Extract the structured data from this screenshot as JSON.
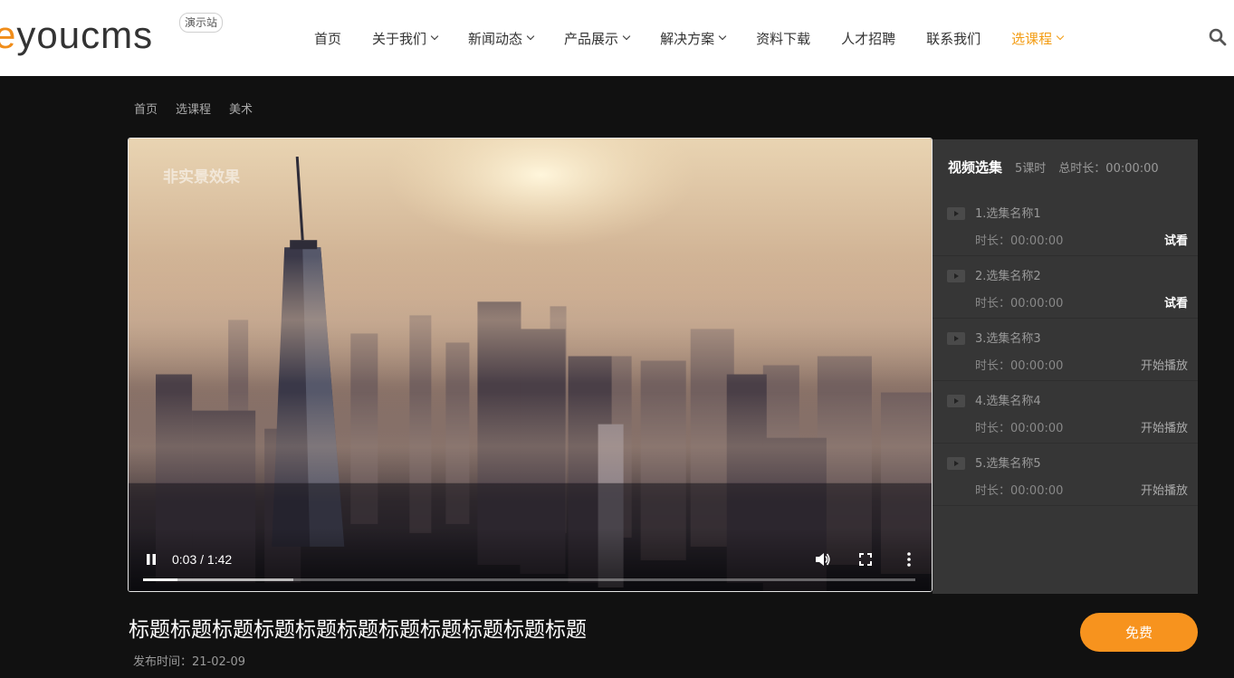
{
  "header": {
    "logo": {
      "accent": "e",
      "rest": "youcms"
    },
    "badge": "演示站",
    "nav": [
      {
        "label": "首页",
        "dropdown": false,
        "active": false
      },
      {
        "label": "关于我们",
        "dropdown": true,
        "active": false
      },
      {
        "label": "新闻动态",
        "dropdown": true,
        "active": false
      },
      {
        "label": "产品展示",
        "dropdown": true,
        "active": false
      },
      {
        "label": "解决方案",
        "dropdown": true,
        "active": false
      },
      {
        "label": "资料下载",
        "dropdown": false,
        "active": false
      },
      {
        "label": "人才招聘",
        "dropdown": false,
        "active": false
      },
      {
        "label": "联系我们",
        "dropdown": false,
        "active": false
      },
      {
        "label": "选课程",
        "dropdown": true,
        "active": true
      }
    ],
    "search_icon": "search-icon"
  },
  "breadcrumb": [
    "首页",
    "选课程",
    "美术"
  ],
  "player": {
    "watermark": "非实景效果",
    "time_display": "0:03 / 1:42",
    "current_time": "0:03",
    "duration": "1:42",
    "played_fraction": 0.045,
    "buffered_fraction": 0.195,
    "icons": [
      "pause-icon",
      "volume-icon",
      "fullscreen-icon",
      "more-vertical-icon"
    ]
  },
  "episodes": {
    "title": "视频选集",
    "count": "5课时",
    "total": "总时长：00:00:00",
    "items": [
      {
        "name": "1.选集名称1",
        "duration": "时长：00:00:00",
        "action": "试看",
        "trial": true
      },
      {
        "name": "2.选集名称2",
        "duration": "时长：00:00:00",
        "action": "试看",
        "trial": true
      },
      {
        "name": "3.选集名称3",
        "duration": "时长：00:00:00",
        "action": "开始播放",
        "trial": false
      },
      {
        "name": "4.选集名称4",
        "duration": "时长：00:00:00",
        "action": "开始播放",
        "trial": false
      },
      {
        "name": "5.选集名称5",
        "duration": "时长：00:00:00",
        "action": "开始播放",
        "trial": false
      }
    ]
  },
  "video": {
    "title": "标题标题标题标题标题标题标题标题标题标题标题",
    "publish": "发布时间：21-02-09",
    "price": "免费"
  },
  "colors": {
    "accent": "#f39c12",
    "button": "#f7931e",
    "page_bg": "#111111",
    "sidebar_bg": "#363636"
  }
}
